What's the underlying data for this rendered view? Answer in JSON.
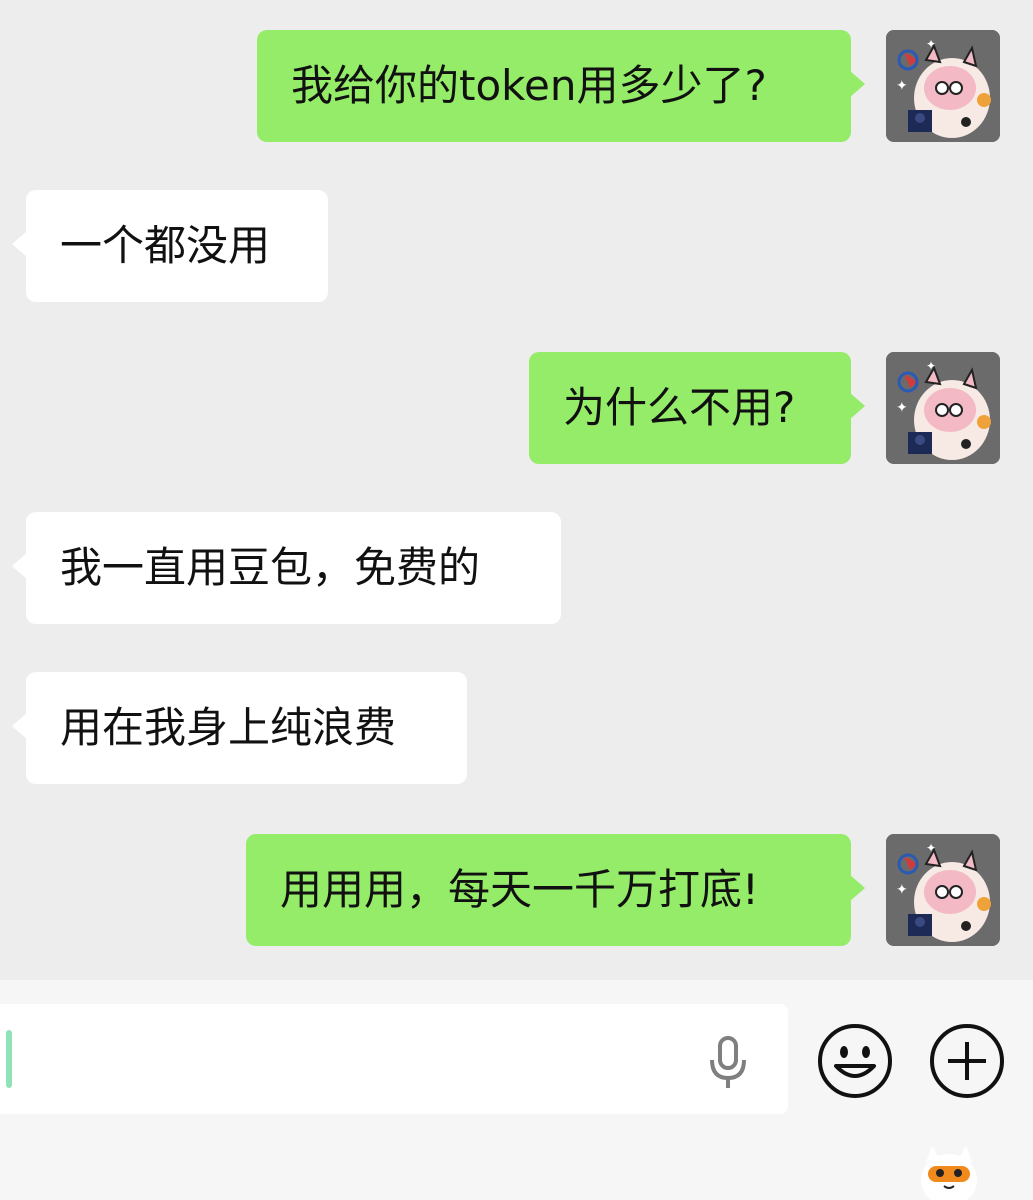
{
  "messages": [
    {
      "side": "out",
      "text": "我给你的token用多少了?"
    },
    {
      "side": "in",
      "text": "一个都没用"
    },
    {
      "side": "out",
      "text": "为什么不用?"
    },
    {
      "side": "in",
      "text": "我一直用豆包，免费的"
    },
    {
      "side": "in",
      "text": "用在我身上纯浪费"
    },
    {
      "side": "out",
      "text": "用用用，每天一千万打底!"
    }
  ],
  "colors": {
    "outgoing_bubble": "#95ec69",
    "incoming_bubble": "#ffffff",
    "background": "#ededed"
  },
  "input_bar": {
    "value": "",
    "icons": [
      "microphone-icon",
      "emoji-icon",
      "plus-icon"
    ]
  }
}
